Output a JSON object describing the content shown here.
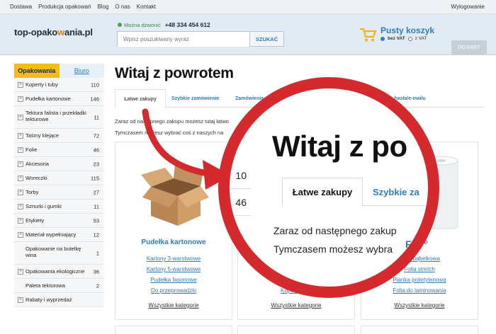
{
  "topnav": {
    "links": [
      "Dostawa",
      "Produkcja opakowań",
      "Blog",
      "O nas",
      "Kontakt"
    ],
    "logout": "Wylogowanie"
  },
  "header": {
    "logo_pre": "top-opako",
    "logo_w": "w",
    "logo_post": "ania.pl",
    "phone_label": "Można dzwonić",
    "phone_number": "+48 334 454 612",
    "search_placeholder": "Wpisz poszukiwany wyraz",
    "search_button": "SZUKAĆ",
    "cart_title": "Pusty koszyk",
    "cart_no_vat": "bez VAT",
    "cart_vat": "z VAT",
    "checkout": "DO KASY"
  },
  "sidebar": {
    "tab_active": "Opakowania",
    "tab_inactive": "Biuro",
    "categories": [
      {
        "label": "Koperty i tuby",
        "count": "110"
      },
      {
        "label": "Pudełka kartonowe",
        "count": "146"
      },
      {
        "label": "Tektura falista i przekładki tekturowe",
        "count": "11"
      },
      {
        "label": "Taśmy klejące",
        "count": "72"
      },
      {
        "label": "Folie",
        "count": "46"
      },
      {
        "label": "Akcesoria",
        "count": "23"
      },
      {
        "label": "Woreczki",
        "count": "115"
      },
      {
        "label": "Torby",
        "count": "27"
      },
      {
        "label": "Sznurki i gumki",
        "count": "11"
      },
      {
        "label": "Etykiety",
        "count": "53"
      },
      {
        "label": "Materiał wypełniający",
        "count": "12"
      },
      {
        "label": "Opakowanie na butelkę wina",
        "count": "1"
      },
      {
        "label": "Opakowania ekologiczne",
        "count": "36"
      },
      {
        "label": "Paleta tekturowa",
        "count": "2"
      },
      {
        "label": "Rabaty i wyprzedaż",
        "count": ""
      }
    ]
  },
  "main": {
    "title": "Witaj z powrotem",
    "tabs": [
      "Łatwe zakupy",
      "Szybkie zamówienie",
      "Zamówienia",
      "Zmiana hasła/e-mailu"
    ],
    "intro_line1": "Zaraz od następnego zakupu możesz tutaj łatwo",
    "intro_line2": "Tymczasem możesz wybrać coś z naszych na",
    "cards": [
      {
        "title": "Pudełka kartonowe",
        "links": [
          "Kartony 3-warstwowe",
          "Kartony 5-warstwowe",
          "Pudełka fasonowe",
          "Do przeprowadzki"
        ],
        "all": "Wszystkie kategorie"
      },
      {
        "title": "",
        "links": [
          "Koperty",
          "Koperty kurierskie"
        ],
        "all": "Wszystkie kategorie"
      },
      {
        "title": "Folie",
        "links": [
          "Folia bąbelkowa",
          "Folia stretch",
          "Pianka polietylenowa",
          "Folia do laminowania"
        ],
        "all": "Wszystkie kategorie"
      }
    ]
  },
  "zoom": {
    "title": "Witaj z po",
    "tab1": "Łatwe zakupy",
    "tab2": "Szybkie za",
    "line1": "Zaraz od następnego zakup",
    "line2": "Tymczasem możesz wybra",
    "num1": "10",
    "num2": "46",
    "folie": "Folie"
  },
  "colors": {
    "accent_blue": "#2e7cc2",
    "tab_yellow": "#f3bb1c",
    "annotation_red": "#d42a2e"
  }
}
